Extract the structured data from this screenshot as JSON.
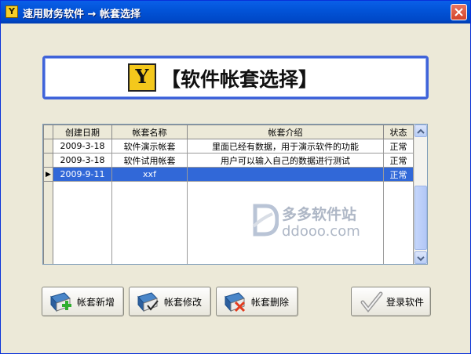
{
  "window": {
    "title": "速用财务软件 → 帐套选择",
    "app_icon_glyph": "Y",
    "close_icon": "close-icon"
  },
  "banner": {
    "icon_glyph": "Y",
    "title": "【软件帐套选择】"
  },
  "grid": {
    "columns": [
      "创建日期",
      "帐套名称",
      "帐套介绍",
      "状态"
    ],
    "rows": [
      {
        "date": "2009-3-18",
        "name": "软件演示帐套",
        "intro": "里面已经有数据，用于演示软件的功能",
        "status": "正常",
        "selected": false
      },
      {
        "date": "2009-3-18",
        "name": "软件试用帐套",
        "intro": "用户可以输入自己的数据进行测试",
        "status": "正常",
        "selected": false
      },
      {
        "date": "2009-9-11",
        "name": "xxf",
        "intro": "",
        "status": "正常",
        "selected": true
      }
    ],
    "current_row_marker": "▶"
  },
  "watermark": {
    "title": "多多软件站",
    "url": "ddooo.com"
  },
  "buttons": {
    "add": "帐套新增",
    "edit": "帐套修改",
    "delete": "帐套删除",
    "login": "登录软件"
  },
  "colors": {
    "titlebar": "#0254D8",
    "selection": "#3168D8",
    "window_bg": "#ECE9D8"
  }
}
